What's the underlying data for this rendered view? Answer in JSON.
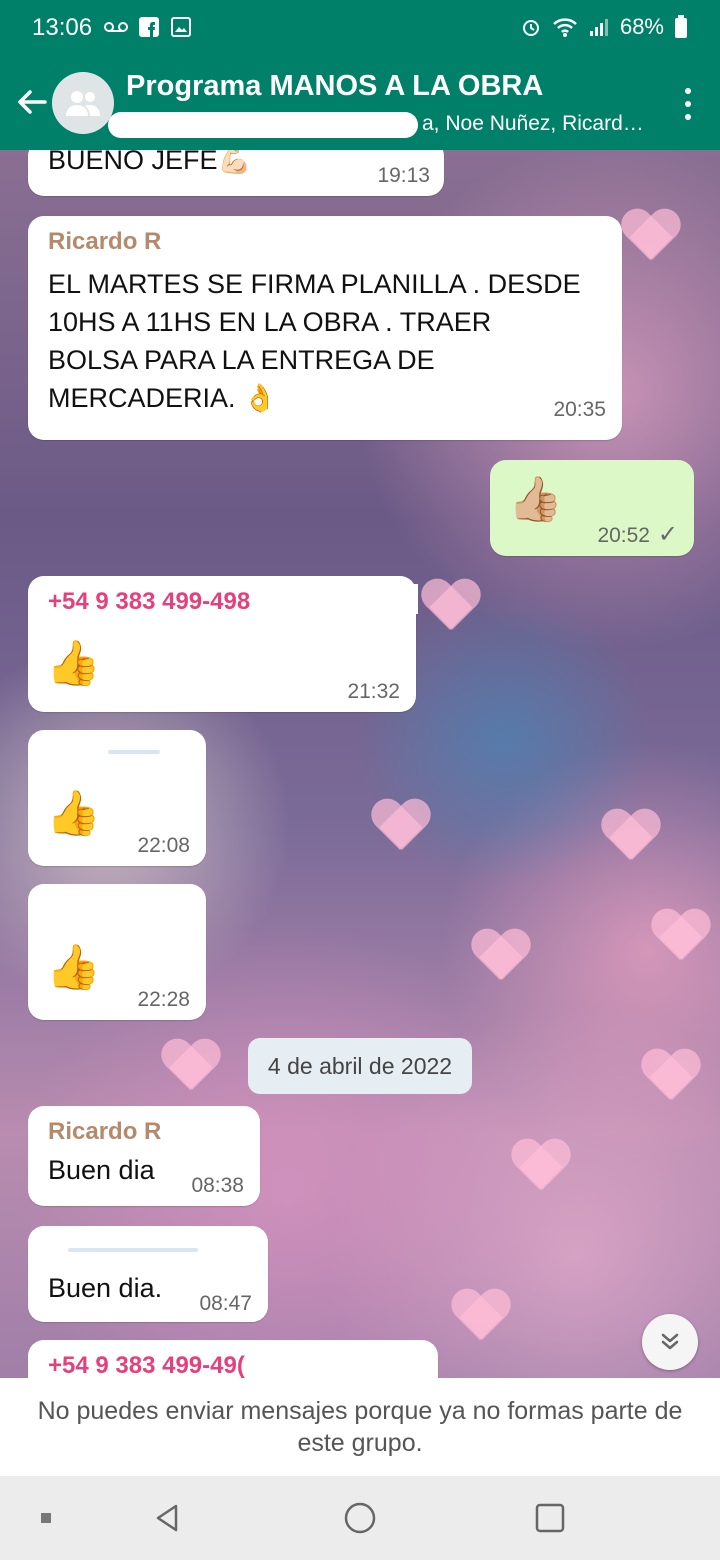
{
  "status_bar": {
    "time": "13:06",
    "battery": "68%",
    "left_icons": [
      "voicemail-icon",
      "facebook-icon",
      "gallery-icon"
    ],
    "right_icons": [
      "alarm-icon",
      "wifi-icon",
      "signal-icon",
      "battery-icon"
    ]
  },
  "header": {
    "title": "Programa MANOS A LA OBRA",
    "members": "a, Noe Nuñez, Ricard…",
    "color": "#008069"
  },
  "messages": [
    {
      "text": "BUENO JEFE💪🏻",
      "time": "19:13"
    },
    {
      "sender": "Ricardo R",
      "lines": [
        "EL MARTES SE FIRMA PLANILLA . DESDE",
        "10HS A 11HS EN LA OBRA . TRAER",
        "BOLSA PARA LA ENTREGA DE",
        "MERCADERIA. 👌"
      ],
      "time": "20:35"
    },
    {
      "emoji": "👍🏼",
      "time": "20:52",
      "tick": "✓"
    },
    {
      "sender": "+54 9 383 499-498",
      "emoji": "👍",
      "time": "21:32"
    },
    {
      "emoji": "👍",
      "time": "22:08"
    },
    {
      "emoji": "👍",
      "time": "22:28"
    },
    {
      "sender": "Ricardo R",
      "text": "Buen dia",
      "time": "08:38"
    },
    {
      "text": "Buen dia.",
      "time": "08:47"
    },
    {
      "sender": "+54 9 383 499-49("
    }
  ],
  "date_separator": "4 de abril de 2022",
  "footer_notice": "No puedes enviar mensajes porque ya no formas parte de este grupo.",
  "colors": {
    "incoming_bubble": "#ffffff",
    "outgoing_bubble": "#dcf8c6",
    "sender_name": "#b58a6c",
    "phone_sender": "#e5407e"
  }
}
